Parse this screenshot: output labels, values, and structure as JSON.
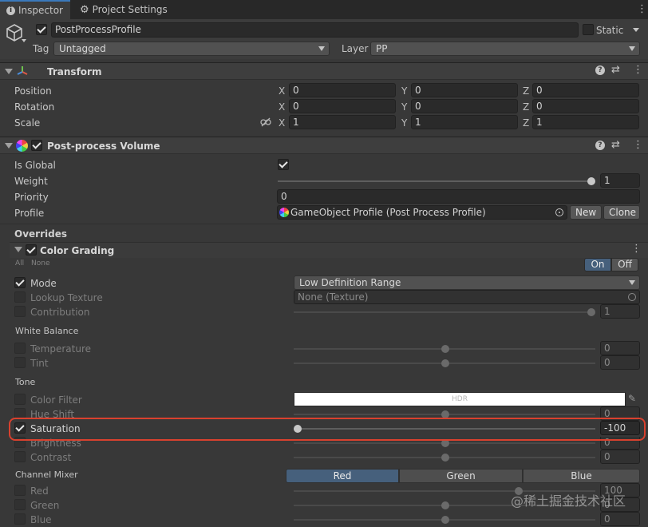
{
  "tabs": [
    {
      "label": "Inspector",
      "icon": "info-icon",
      "active": true
    },
    {
      "label": "Project Settings",
      "icon": "gear-icon",
      "active": false
    }
  ],
  "object": {
    "name": "PostProcessProfile",
    "static_label": "Static",
    "tag_label": "Tag",
    "tag_value": "Untagged",
    "layer_label": "Layer",
    "layer_value": "PP"
  },
  "transform": {
    "title": "Transform",
    "rows": [
      {
        "label": "Position",
        "x": "0",
        "y": "0",
        "z": "0"
      },
      {
        "label": "Rotation",
        "x": "0",
        "y": "0",
        "z": "0"
      },
      {
        "label": "Scale",
        "x": "1",
        "y": "1",
        "z": "1"
      }
    ],
    "axis_x": "X",
    "axis_y": "Y",
    "axis_z": "Z"
  },
  "volume": {
    "title": "Post-process Volume",
    "is_global_label": "Is Global",
    "weight_label": "Weight",
    "weight_value": "1",
    "priority_label": "Priority",
    "priority_value": "0",
    "profile_label": "Profile",
    "profile_value": "GameObject Profile (Post Process Profile)",
    "new_label": "New",
    "clone_label": "Clone",
    "overrides_label": "Overrides"
  },
  "color_grading": {
    "title": "Color Grading",
    "all_label": "All",
    "none_label": "None",
    "on_label": "On",
    "off_label": "Off",
    "mode_label": "Mode",
    "mode_value": "Low Definition Range",
    "lookup_label": "Lookup Texture",
    "lookup_value": "None (Texture)",
    "contribution_label": "Contribution",
    "contribution_value": "1",
    "white_balance_label": "White Balance",
    "temperature_label": "Temperature",
    "temperature_value": "0",
    "tint_label": "Tint",
    "tint_value": "0",
    "tone_label": "Tone",
    "color_filter_label": "Color Filter",
    "hdr_label": "HDR",
    "hue_shift_label": "Hue Shift",
    "hue_shift_value": "0",
    "saturation_label": "Saturation",
    "saturation_value": "-100",
    "brightness_label": "Brightness",
    "brightness_value": "0",
    "contrast_label": "Contrast",
    "contrast_value": "0",
    "channel_mixer_label": "Channel Mixer",
    "mixer_tabs": [
      "Red",
      "Green",
      "Blue"
    ],
    "red_label": "Red",
    "red_value": "100",
    "green_label": "Green",
    "green_value": "0",
    "blue_label": "Blue",
    "blue_value": "0"
  },
  "watermark": "@稀土掘金技术社区",
  "colors": {
    "accent": "#3a79bb",
    "highlight": "#d9412e",
    "panel_bg": "#383838"
  }
}
